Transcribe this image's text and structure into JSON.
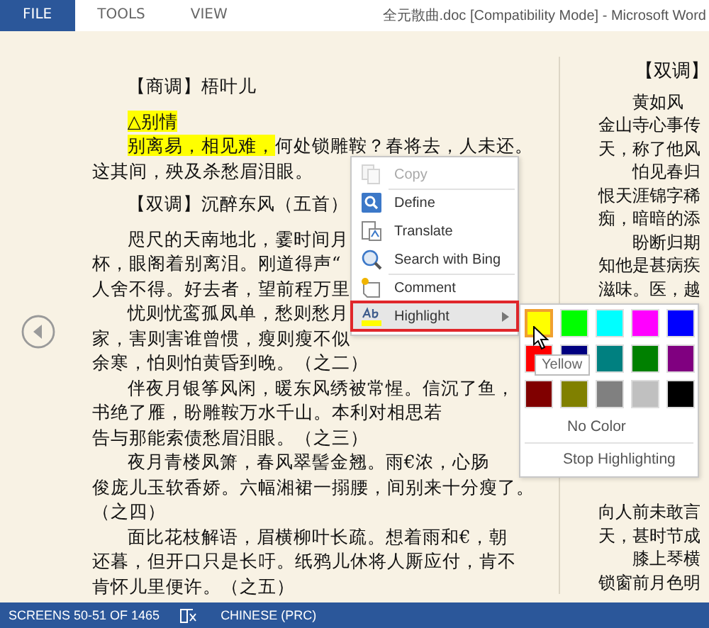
{
  "title_bar": {
    "tabs": [
      {
        "label": "FILE",
        "selected": true
      },
      {
        "label": "TOOLS",
        "selected": false
      },
      {
        "label": "VIEW",
        "selected": false
      }
    ],
    "title": "全元散曲.doc [Compatibility Mode] - Microsoft Word"
  },
  "left_page": {
    "lines": [
      {
        "kind": "heading",
        "indent": true,
        "segments": [
          {
            "text": "【商调】梧叶儿",
            "highlighted": false
          }
        ]
      },
      {
        "kind": "text",
        "indent": true,
        "segments": [
          {
            "text": "△别情",
            "highlighted": true
          }
        ]
      },
      {
        "kind": "text",
        "indent": true,
        "segments": [
          {
            "text": "别离易，相见难，",
            "highlighted": true
          },
          {
            "text": "何处锁雕鞍？春将去，人未还。",
            "highlighted": false
          }
        ]
      },
      {
        "kind": "text",
        "indent": false,
        "segments": [
          {
            "text": "这其间，殃及杀愁眉泪眼。",
            "highlighted": false
          }
        ]
      },
      {
        "kind": "heading",
        "indent": true,
        "segments": [
          {
            "text": "【双调】沉醉东风（五首）",
            "highlighted": false
          }
        ]
      },
      {
        "kind": "text",
        "indent": true,
        "segments": [
          {
            "text": "咫尺的天南地北，霎时间月",
            "highlighted": false
          }
        ]
      },
      {
        "kind": "text",
        "indent": false,
        "segments": [
          {
            "text": "杯，眼阁着别离泪。刚道得声“",
            "highlighted": false
          }
        ]
      },
      {
        "kind": "text",
        "indent": false,
        "segments": [
          {
            "text": "人舍不得。好去者，望前程万里",
            "highlighted": false
          }
        ]
      },
      {
        "kind": "text",
        "indent": true,
        "segments": [
          {
            "text": "忧则忧鸾孤凤单，愁则愁月",
            "highlighted": false
          }
        ]
      },
      {
        "kind": "text",
        "indent": false,
        "segments": [
          {
            "text": "家，害则害谁曾惯，瘦则瘦不似",
            "highlighted": false
          }
        ]
      },
      {
        "kind": "text",
        "indent": false,
        "segments": [
          {
            "text": "余寒，怕则怕黄昏到晚。（之二）",
            "highlighted": false
          }
        ]
      },
      {
        "kind": "text",
        "indent": true,
        "segments": [
          {
            "text": "伴夜月银筝风闲，暖东风绣被常惺。信沉了鱼，",
            "highlighted": false
          }
        ]
      },
      {
        "kind": "text",
        "indent": false,
        "segments": [
          {
            "text": "书绝了雁，盼雕鞍万水千山。本利对相思若",
            "highlighted": false
          }
        ]
      },
      {
        "kind": "text",
        "indent": false,
        "segments": [
          {
            "text": "告与那能索债愁眉泪眼。（之三）",
            "highlighted": false
          }
        ]
      },
      {
        "kind": "text",
        "indent": true,
        "segments": [
          {
            "text": "夜月青楼凤箫，春风翠髻金翘。雨€浓，心肠",
            "highlighted": false
          }
        ]
      },
      {
        "kind": "text",
        "indent": false,
        "segments": [
          {
            "text": "俊庞儿玉软香娇。六幅湘裙一搦腰，间别来十分瘦了。",
            "highlighted": false
          }
        ]
      },
      {
        "kind": "text",
        "indent": false,
        "segments": [
          {
            "text": "（之四）",
            "highlighted": false
          }
        ]
      },
      {
        "kind": "text",
        "indent": true,
        "segments": [
          {
            "text": "面比花枝解语，眉横柳叶长疏。想着雨和€，朝",
            "highlighted": false
          }
        ]
      },
      {
        "kind": "text",
        "indent": false,
        "segments": [
          {
            "text": "还暮，但开口只是长吁。纸鸦儿休将人厮应付，肯不",
            "highlighted": false
          }
        ]
      },
      {
        "kind": "text",
        "indent": false,
        "segments": [
          {
            "text": "肯怀儿里便许。（之五）",
            "highlighted": false
          }
        ]
      }
    ]
  },
  "right_page": {
    "lines": [
      {
        "kind": "heading",
        "indent": true,
        "text": "【双调】"
      },
      {
        "kind": "text",
        "indent": true,
        "text": "黄如风"
      },
      {
        "kind": "text",
        "indent": false,
        "text": "金山寺心事传"
      },
      {
        "kind": "text",
        "indent": false,
        "text": "天，称了他风"
      },
      {
        "kind": "text",
        "indent": true,
        "text": "怕见春归"
      },
      {
        "kind": "text",
        "indent": false,
        "text": "恨天涯锦字稀"
      },
      {
        "kind": "text",
        "indent": false,
        "text": "痴，暗暗的添"
      },
      {
        "kind": "text",
        "indent": true,
        "text": "盼断归期"
      },
      {
        "kind": "text",
        "indent": false,
        "text": "知他是甚病疾"
      },
      {
        "kind": "text",
        "indent": false,
        "text": "滋味。医，越"
      }
    ],
    "lines_below_menu": [
      {
        "indent": false,
        "text": "向人前未敢言"
      },
      {
        "indent": false,
        "text": "天，甚时节成"
      },
      {
        "indent": true,
        "text": "膝上琴横"
      },
      {
        "indent": false,
        "text": "锁窗前月色明"
      }
    ]
  },
  "context_menu": {
    "items": [
      {
        "kind": "copy",
        "label": "Copy",
        "disabled": true,
        "selected": false,
        "submenu": false,
        "separator_before": false
      },
      {
        "kind": "define",
        "label": "Define",
        "disabled": false,
        "selected": false,
        "submenu": false,
        "separator_before": true
      },
      {
        "kind": "translate",
        "label": "Translate",
        "disabled": false,
        "selected": false,
        "submenu": false,
        "separator_before": false
      },
      {
        "kind": "search",
        "label": "Search with Bing",
        "disabled": false,
        "selected": false,
        "submenu": false,
        "separator_before": false
      },
      {
        "kind": "comment",
        "label": "Comment",
        "disabled": false,
        "selected": false,
        "submenu": false,
        "separator_before": true
      },
      {
        "kind": "highlight",
        "label": "Highlight",
        "disabled": false,
        "selected": true,
        "submenu": true,
        "separator_before": false
      }
    ]
  },
  "highlight_submenu": {
    "swatches": [
      {
        "color": "#ffff00",
        "selected": true
      },
      {
        "color": "#00ff00",
        "selected": false
      },
      {
        "color": "#00ffff",
        "selected": false
      },
      {
        "color": "#ff00ff",
        "selected": false
      },
      {
        "color": "#0000ff",
        "selected": false
      },
      {
        "color": "#ff0000",
        "selected": false
      },
      {
        "color": "#000080",
        "selected": false
      },
      {
        "color": "#008080",
        "selected": false
      },
      {
        "color": "#008000",
        "selected": false
      },
      {
        "color": "#800080",
        "selected": false
      },
      {
        "color": "#800000",
        "selected": false
      },
      {
        "color": "#808000",
        "selected": false
      },
      {
        "color": "#808080",
        "selected": false
      },
      {
        "color": "#c0c0c0",
        "selected": false
      },
      {
        "color": "#000000",
        "selected": false
      }
    ],
    "no_color": "No Color",
    "stop": "Stop Highlighting",
    "tooltip": "Yellow"
  },
  "status_bar": {
    "page_info": "SCREENS 50-51 OF 1465",
    "language": "CHINESE (PRC)"
  }
}
